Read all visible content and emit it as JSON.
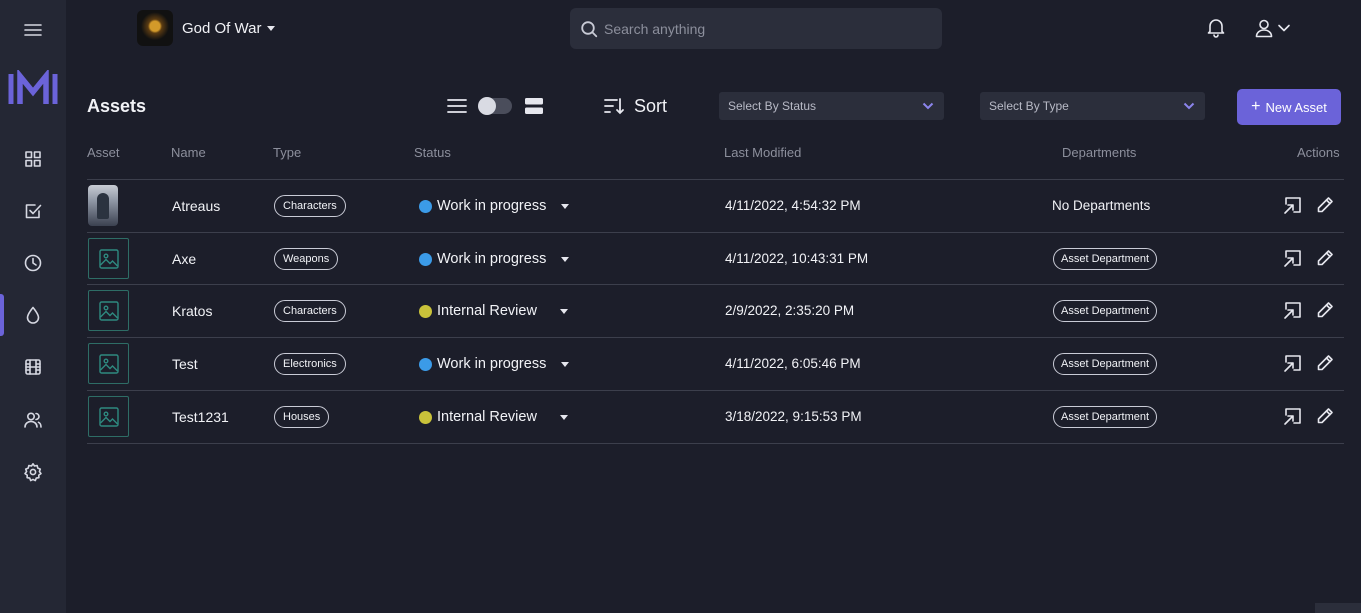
{
  "project": {
    "name": "God Of War"
  },
  "search": {
    "placeholder": "Search anything"
  },
  "toolbar": {
    "title": "Assets",
    "sort_label": "Sort",
    "status_filter": "Select By Status",
    "type_filter": "Select By Type",
    "new_asset_label": "New Asset"
  },
  "table": {
    "headers": {
      "asset": "Asset",
      "name": "Name",
      "type": "Type",
      "status": "Status",
      "modified": "Last Modified",
      "departments": "Departments",
      "actions": "Actions"
    },
    "rows": [
      {
        "name": "Atreaus",
        "type": "Characters",
        "status": "Work in progress",
        "modified": "4/11/2022, 4:54:32 PM",
        "department": "No Departments"
      },
      {
        "name": "Axe",
        "type": "Weapons",
        "status": "Work in progress",
        "modified": "4/11/2022, 10:43:31 PM",
        "department": "Asset Department"
      },
      {
        "name": "Kratos",
        "type": "Characters",
        "status": "Internal Review",
        "modified": "2/9/2022, 2:35:20 PM",
        "department": "Asset Department"
      },
      {
        "name": "Test",
        "type": "Electronics",
        "status": "Work in progress",
        "modified": "4/11/2022, 6:05:46 PM",
        "department": "Asset Department"
      },
      {
        "name": "Test1231",
        "type": "Houses",
        "status": "Internal Review",
        "modified": "3/18/2022, 9:15:53 PM",
        "department": "Asset Department"
      }
    ]
  },
  "colors": {
    "accent": "#6b63d9",
    "status_work_in_progress": "#3b9be8",
    "status_internal_review": "#c9c23a"
  },
  "icons": [
    "menu-icon",
    "logo",
    "dashboard-icon",
    "tasks-icon",
    "history-icon",
    "assets-icon",
    "film-icon",
    "users-icon",
    "settings-icon",
    "search-icon",
    "bell-icon",
    "user-icon",
    "list-view-icon",
    "grid-view-icon",
    "sort-icon",
    "image-placeholder-icon",
    "open-icon",
    "edit-icon"
  ]
}
